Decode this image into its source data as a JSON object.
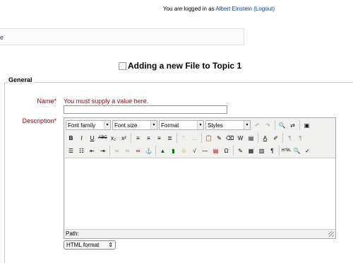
{
  "header": {
    "logged_prefix": "You are logged in as ",
    "user_name": "Albert Einstein",
    "logout": "(Logout)"
  },
  "navbar": {
    "fragment": "e"
  },
  "page": {
    "title": "Adding a new File to Topic 1"
  },
  "form": {
    "section": "General",
    "name_label": "Name",
    "required_mark": "*",
    "name_error": "You must supply a value here.",
    "desc_label": "Description",
    "name_value": ""
  },
  "editor": {
    "font_family": "Font family",
    "font_size": "Font size",
    "format": "Format",
    "styles": "Styles",
    "path_label": "Path:",
    "text_format": "HTML format"
  }
}
